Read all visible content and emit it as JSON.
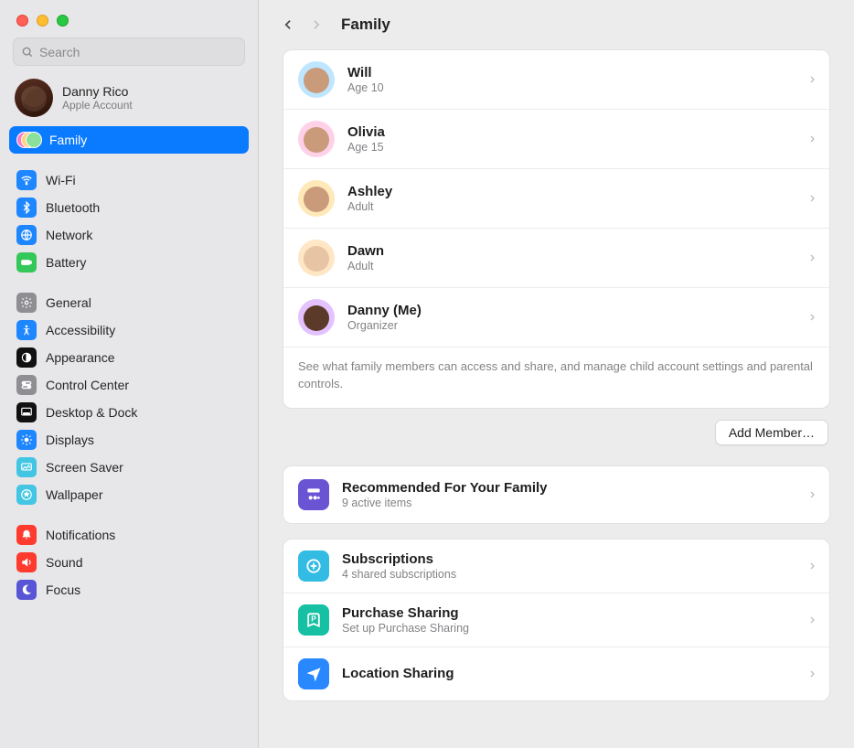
{
  "search": {
    "placeholder": "Search"
  },
  "account": {
    "name": "Danny Rico",
    "sub": "Apple Account"
  },
  "sidebar": {
    "family": "Family",
    "items": [
      {
        "label": "Wi-Fi"
      },
      {
        "label": "Bluetooth"
      },
      {
        "label": "Network"
      },
      {
        "label": "Battery"
      }
    ],
    "items2": [
      {
        "label": "General"
      },
      {
        "label": "Accessibility"
      },
      {
        "label": "Appearance"
      },
      {
        "label": "Control Center"
      },
      {
        "label": "Desktop & Dock"
      },
      {
        "label": "Displays"
      },
      {
        "label": "Screen Saver"
      },
      {
        "label": "Wallpaper"
      }
    ],
    "items3": [
      {
        "label": "Notifications"
      },
      {
        "label": "Sound"
      },
      {
        "label": "Focus"
      }
    ]
  },
  "header": {
    "title": "Family"
  },
  "members": [
    {
      "name": "Will",
      "sub": "Age 10",
      "bg": "#bfe6ff",
      "skin": "#c99b7b"
    },
    {
      "name": "Olivia",
      "sub": "Age 15",
      "bg": "#ffd1e8",
      "skin": "#c99b7b"
    },
    {
      "name": "Ashley",
      "sub": "Adult",
      "bg": "#ffe9b8",
      "skin": "#c99b7b"
    },
    {
      "name": "Dawn",
      "sub": "Adult",
      "bg": "#ffe6c4",
      "skin": "#e7c4a4"
    },
    {
      "name": "Danny (Me)",
      "sub": "Organizer",
      "bg": "#e3c2ff",
      "skin": "#5c3a29"
    }
  ],
  "members_footnote": "See what family members can access and share, and manage child account settings and parental controls.",
  "add_member": "Add Member…",
  "recommended": {
    "title": "Recommended For Your Family",
    "sub": "9 active items"
  },
  "features": [
    {
      "title": "Subscriptions",
      "sub": "4 shared subscriptions"
    },
    {
      "title": "Purchase Sharing",
      "sub": "Set up Purchase Sharing"
    },
    {
      "title": "Location Sharing",
      "sub": ""
    }
  ]
}
